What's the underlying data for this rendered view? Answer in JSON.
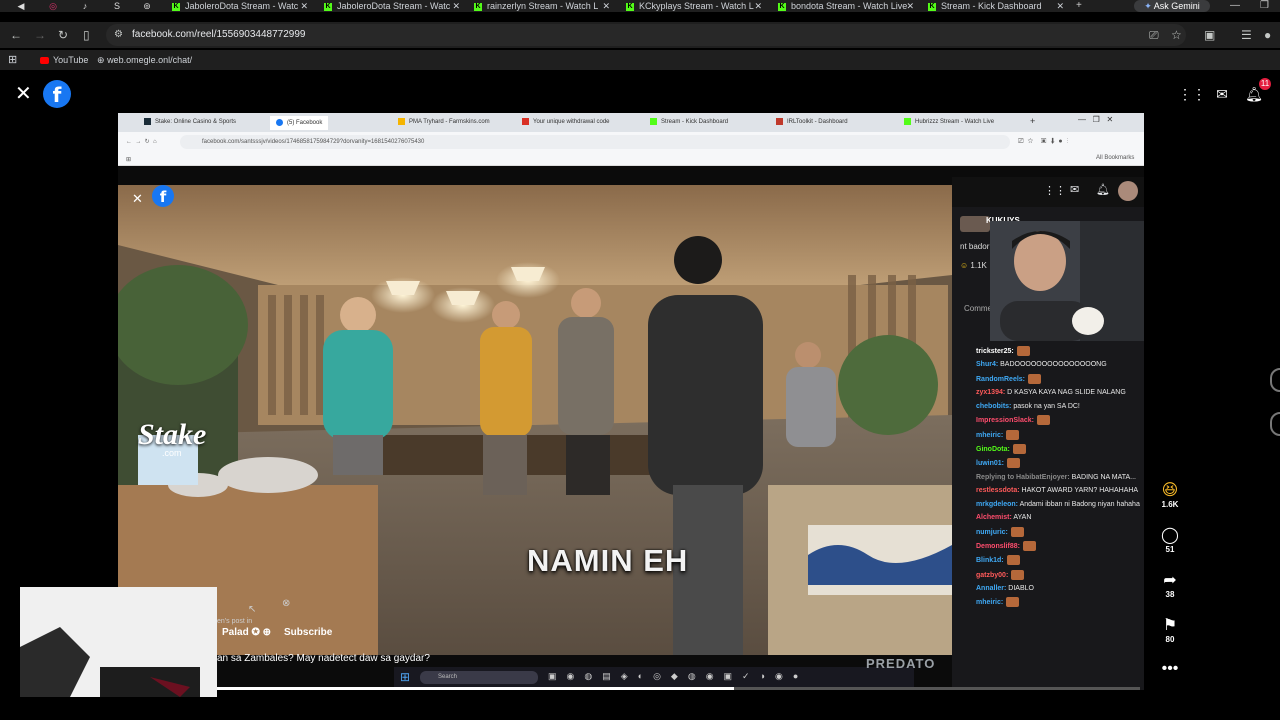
{
  "browser": {
    "tabs": [
      {
        "label": "JaboleroDota Stream - Watc"
      },
      {
        "label": "JaboleroDota Stream - Watc"
      },
      {
        "label": "rainzerlyn Stream - Watch L"
      },
      {
        "label": "KCkyplays Stream - Watch L"
      },
      {
        "label": "bondota Stream - Watch Live"
      },
      {
        "label": "Stream - Kick Dashboard"
      }
    ],
    "ask_gemini": "Ask Gemini",
    "url": "facebook.com/reel/1556903448772999",
    "bookmarks": [
      {
        "label": "YouTube"
      },
      {
        "label": "web.omegle.onl/chat/"
      }
    ]
  },
  "facebook": {
    "logo": "f",
    "notification_count": "11",
    "actions": [
      {
        "name": "like",
        "count": "1.6K"
      },
      {
        "name": "comment",
        "count": "51"
      },
      {
        "name": "share",
        "count": "38"
      },
      {
        "name": "save",
        "count": "80"
      }
    ],
    "author": "Palad",
    "post_meta": "en's post in",
    "subscribe": "Subscribe",
    "description": "an sa Zambales? May nadetect daw sa gaydar?",
    "progress": 0.56
  },
  "inner_browser": {
    "tabs": [
      {
        "label": "Stake: Online Casino & Sports",
        "color": "#1a2c38"
      },
      {
        "label": "(5) Facebook",
        "color": "#1877f2"
      },
      {
        "label": "PMA Tryhard - Farmskins.com",
        "color": "#f5b400"
      },
      {
        "label": "Your unique withdrawal code",
        "color": "#d93025"
      },
      {
        "label": "Stream - Kick Dashboard",
        "color": "#53fc18"
      },
      {
        "label": "IRLToolkit - Dashboard",
        "color": "#c0392b"
      },
      {
        "label": "Hubrizzz Stream - Watch Live",
        "color": "#53fc18"
      }
    ],
    "url": "facebook.com/santsssjv/videos/1746858175984729?dorvanity=1681540276075430",
    "all_bookmarks": "All Bookmarks"
  },
  "video": {
    "caption": "NAMIN EH",
    "stake_logo": "Stake",
    "stake_sub": ".com",
    "watermark": "PREDATO"
  },
  "kick": {
    "streamer": "KUKUYS",
    "snippet": "nt bador",
    "reactions": "1.1K",
    "comment_label": "Comme",
    "chat": [
      {
        "user": "trickster25:",
        "msg": "",
        "color": "#ffffff"
      },
      {
        "user": "Shur4:",
        "msg": "BADOOOOOOOOOOOOOOONG",
        "color": "#3fa9f5"
      },
      {
        "user": "RandomReels:",
        "msg": "",
        "color": "#3fa9f5"
      },
      {
        "user": "zyx1394:",
        "msg": "D KASYA KAYA NAG SLIDE NALANG",
        "color": "#ff5a5a"
      },
      {
        "user": "chebobits:",
        "msg": "pasok na yan SA DC!",
        "color": "#3fa9f5"
      },
      {
        "user": "ImpressionSlack:",
        "msg": "",
        "color": "#ff4d6d"
      },
      {
        "user": "mheiric:",
        "msg": "",
        "color": "#3fa9f5"
      },
      {
        "user": "GinoDota:",
        "msg": "",
        "color": "#53fc18"
      },
      {
        "user": "luwin01:",
        "msg": "",
        "color": "#3fa9f5"
      },
      {
        "user": "Replying to HabibatEnjoyer:",
        "msg": "BADING NA MATA...",
        "color": "#8a8a8a"
      },
      {
        "user": "restlessdota:",
        "msg": "HAKOT AWARD YARN? HAHAHAHA",
        "color": "#ff5a5a"
      },
      {
        "user": "mrkgdeleon:",
        "msg": "Andami ibban ni Badong niyan hahaha",
        "color": "#3fa9f5"
      },
      {
        "user": "Alchemist:",
        "msg": "AYAN",
        "color": "#ff4d6d"
      },
      {
        "user": "numjuric:",
        "msg": "",
        "color": "#3fa9f5"
      },
      {
        "user": "Demonslif88:",
        "msg": "",
        "color": "#ff4d6d"
      },
      {
        "user": "Blink1d:",
        "msg": "",
        "color": "#3fa9f5"
      },
      {
        "user": "gatzby00:",
        "msg": "",
        "color": "#ff5a5a"
      },
      {
        "user": "Annaller:",
        "msg": "DIABLO",
        "color": "#3fa9f5"
      },
      {
        "user": "mheiric:",
        "msg": "",
        "color": "#3fa9f5"
      }
    ]
  },
  "windows_taskbar": {
    "search_placeholder": "Search"
  }
}
